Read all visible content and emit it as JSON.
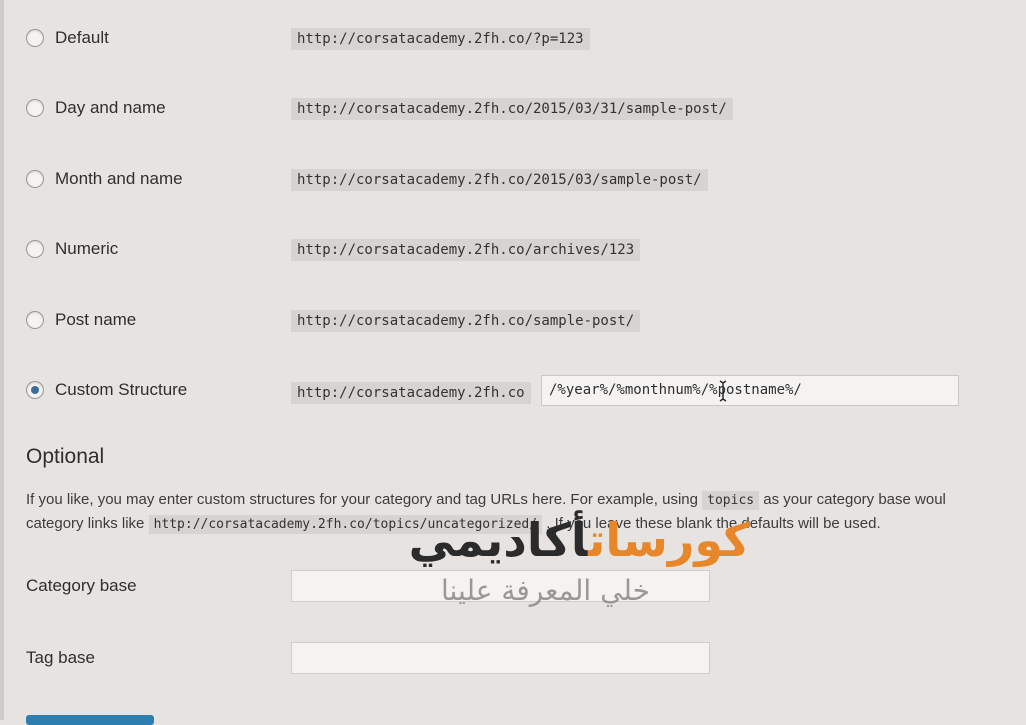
{
  "permalink_options": [
    {
      "label": "Default",
      "example": "http://corsatacademy.2fh.co/?p=123",
      "checked": false
    },
    {
      "label": "Day and name",
      "example": "http://corsatacademy.2fh.co/2015/03/31/sample-post/",
      "checked": false
    },
    {
      "label": "Month and name",
      "example": "http://corsatacademy.2fh.co/2015/03/sample-post/",
      "checked": false
    },
    {
      "label": "Numeric",
      "example": "http://corsatacademy.2fh.co/archives/123",
      "checked": false
    },
    {
      "label": "Post name",
      "example": "http://corsatacademy.2fh.co/sample-post/",
      "checked": false
    },
    {
      "label": "Custom Structure",
      "example": "http://corsatacademy.2fh.co",
      "checked": true
    }
  ],
  "custom_structure_value": "/%year%/%monthnum%/%postname%/",
  "optional": {
    "title": "Optional",
    "text_part1": "If you like, you may enter custom structures for your category and tag URLs here. For example, using ",
    "code_topics": "topics",
    "text_part2": " as your category base woul",
    "text_part3": "category links like ",
    "code_example": "http://corsatacademy.2fh.co/topics/uncategorized/",
    "text_part4": " . If you leave these blank the defaults will be used."
  },
  "category_base": {
    "label": "Category base",
    "value": ""
  },
  "tag_base": {
    "label": "Tag base",
    "value": ""
  },
  "watermark": {
    "main_orange": "كورسات",
    "main_dark": "أكاديمي",
    "subtitle": "خلي المعرفة علينا"
  },
  "colors": {
    "accent": "#3a6e9a",
    "watermark_orange": "#e8862a",
    "background": "#e6e3e0"
  }
}
